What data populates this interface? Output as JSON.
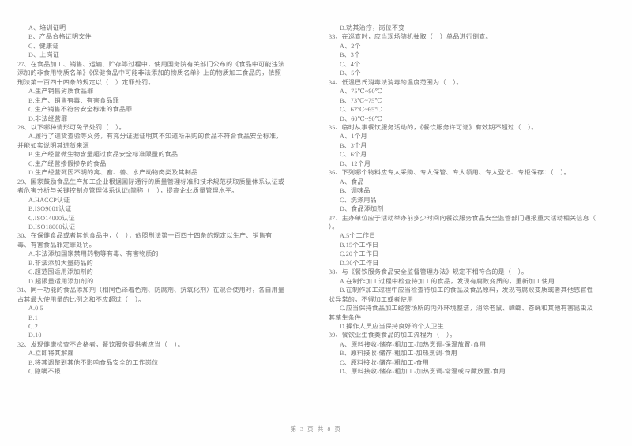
{
  "document": {
    "type": "exam-paper",
    "language": "zh-CN",
    "page_footer": "第 3 页 共 8 页"
  },
  "left_column": {
    "lines": [
      {
        "kind": "opt",
        "text": "A、培训证明"
      },
      {
        "kind": "opt",
        "text": "B、产品合格证明文件"
      },
      {
        "kind": "opt",
        "text": "C、健康证"
      },
      {
        "kind": "opt",
        "text": "D、上岗证"
      },
      {
        "kind": "q",
        "text": "27、在食品加工、销售、运输、贮存等过程中，使用国务院有关部门公布的《食品中可能违法"
      },
      {
        "kind": "q-cont",
        "text": "添加的非食用物质名单》《保健食品中可能非法添加的物质名单》上的物质加工食品的，依照"
      },
      {
        "kind": "q-cont",
        "text": "刑法第一百四十四条的规定以（    ）定罪处罚。"
      },
      {
        "kind": "opt",
        "text": "A.生产销售劣质食品罪"
      },
      {
        "kind": "opt",
        "text": "B.生产、销售有毒、有害食品罪"
      },
      {
        "kind": "opt",
        "text": "C.生产销售不符合安全标准的食品罪"
      },
      {
        "kind": "opt",
        "text": "D.非法经营罪"
      },
      {
        "kind": "q",
        "text": "28、以下哪种情形可免予处罚（    ）。"
      },
      {
        "kind": "opt",
        "text": "A.履行了进货查验等义务，有充分证据证明其不知道所采购的食品不符合食品安全标准，"
      },
      {
        "kind": "q-cont",
        "text": "并能如实说明其进货来源"
      },
      {
        "kind": "opt",
        "text": "B.生产经营微生物含量超过食品安全标准限量的食品"
      },
      {
        "kind": "opt",
        "text": "C.生产经营掺假掺杂的食品"
      },
      {
        "kind": "opt",
        "text": "D.生产经营死因不明的禽、畜、兽、水产动物肉类及其制品"
      },
      {
        "kind": "q",
        "text": "29、国家鼓励食品生产加工企业根据国际通行的质量管理标准和技术规范获取质量体系认证或"
      },
      {
        "kind": "q-cont",
        "text": "者危害分析与关键控制点管理体系认证(简称（    ），提高企业质量管理水平。"
      },
      {
        "kind": "opt",
        "text": "A.HACCP认证"
      },
      {
        "kind": "opt",
        "text": "B.ISO9001认证"
      },
      {
        "kind": "opt",
        "text": "C.ISO14000认证"
      },
      {
        "kind": "opt",
        "text": "D.ISO18000认证"
      },
      {
        "kind": "q",
        "text": "30、在保健食品或者其他食品中，（    ），依照刑法第一百四十四条的规定以生产、销售有"
      },
      {
        "kind": "q-cont",
        "text": "毒、有害食品罪定罪处罚。"
      },
      {
        "kind": "opt",
        "text": "A.非法添加国家禁用药物等有毒、有害物质的"
      },
      {
        "kind": "opt",
        "text": "B.非法添加大量药品的"
      },
      {
        "kind": "opt",
        "text": "C.超范围适用添加剂的"
      },
      {
        "kind": "opt",
        "text": "D.超限量适用添加剂的"
      },
      {
        "kind": "q",
        "text": "31、同一功能的食品添加剂（相同色泽着色剂、防腐剂、抗氧化剂）在混合使用时，各自用量"
      },
      {
        "kind": "q-cont",
        "text": "占其最大使用量的比例之和不应超过（    ）。"
      },
      {
        "kind": "opt",
        "text": "A.0.5"
      },
      {
        "kind": "opt",
        "text": "B.1"
      },
      {
        "kind": "opt",
        "text": "C.2"
      },
      {
        "kind": "opt",
        "text": "D.10"
      },
      {
        "kind": "q",
        "text": "32、发现健康检查不合格者，餐饮服务提供者应当（    ）。"
      },
      {
        "kind": "opt",
        "text": "A.立即将其解雇"
      },
      {
        "kind": "opt",
        "text": "B.将其调整到其他不影响食品安全的工作岗位"
      },
      {
        "kind": "opt",
        "text": "C.隐瞒不报"
      }
    ]
  },
  "right_column": {
    "lines": [
      {
        "kind": "opt",
        "text": "D.劝其治疗，岗位不变"
      },
      {
        "kind": "q",
        "text": "33、在巡查时，应当现场随机抽取（    ）单品进行倒查。"
      },
      {
        "kind": "opt",
        "text": "A、2个"
      },
      {
        "kind": "opt",
        "text": "B、3个"
      },
      {
        "kind": "opt",
        "text": "C、4个"
      },
      {
        "kind": "opt",
        "text": "D、5个"
      },
      {
        "kind": "q",
        "text": "34、低温巴氏消毒法消毒的温度范围为（    ）。"
      },
      {
        "kind": "opt",
        "text": "A、75℃~90℃"
      },
      {
        "kind": "opt",
        "text": "B、73℃~75℃"
      },
      {
        "kind": "opt",
        "text": "C、62℃~65℃"
      },
      {
        "kind": "opt",
        "text": "D、60℃~90℃"
      },
      {
        "kind": "q",
        "text": "35、临时从事餐饮服务活动的，《餐饮服务许可证》有效期不超过（    ）。"
      },
      {
        "kind": "opt",
        "text": "A、1个月"
      },
      {
        "kind": "opt",
        "text": "B、3个月"
      },
      {
        "kind": "opt",
        "text": "C、6个月"
      },
      {
        "kind": "opt",
        "text": "D、12个月"
      },
      {
        "kind": "q",
        "text": "36、下列哪个物料应专人采购、专人保管、专人领用、专人登记、专柜保存：（    ）。"
      },
      {
        "kind": "opt",
        "text": "A、食品"
      },
      {
        "kind": "opt",
        "text": "B、调味品"
      },
      {
        "kind": "opt",
        "text": "C、洗涤用品"
      },
      {
        "kind": "opt",
        "text": "D、食品添加剂"
      },
      {
        "kind": "q",
        "text": "37、主办单位应于活动举办前多少时间向餐饮服务食品安全监管部门通报重大活动相关信息（"
      },
      {
        "kind": "q-cont",
        "text": "）。"
      },
      {
        "kind": "opt",
        "text": "A.5个工作日"
      },
      {
        "kind": "opt",
        "text": "B.15个工作日"
      },
      {
        "kind": "opt",
        "text": "C.20个工作日"
      },
      {
        "kind": "opt",
        "text": "D.30个工作日"
      },
      {
        "kind": "q",
        "text": "38、与《餐饮服务食品安全监督管理办法》规定不相符合的是（    ）。"
      },
      {
        "kind": "opt",
        "text": "A.在制作加工过程中检查待加工的食品，发现有腐败变质的，重新加工使用"
      },
      {
        "kind": "opt",
        "text": "B.在制作加工过程中应当检查待加工的食品及食品原料，发现有腐败变质或者其他感官性"
      },
      {
        "kind": "q-cont",
        "text": "状异常的，不得加工或者使用"
      },
      {
        "kind": "opt",
        "text": "C.应当保持食品加工经营场所的内外环境整洁，消除老鼠、蟑螂、苍蝇和其他有害昆虫及"
      },
      {
        "kind": "q-cont",
        "text": "其孳生条件"
      },
      {
        "kind": "opt",
        "text": "D.操作人员应当保持良好的个人卫生"
      },
      {
        "kind": "q",
        "text": "39、餐饮业生食类食品的加工流程为（    ）。"
      },
      {
        "kind": "opt",
        "text": "A、原料接收-储存-粗加工-加热烹调-保温放置-食用"
      },
      {
        "kind": "opt",
        "text": "B、原料接收-储存-粗加工-加热烹调-食用"
      },
      {
        "kind": "opt",
        "text": "C、原料接收-储存-粗加工-食用"
      },
      {
        "kind": "opt",
        "text": "D、原料接收-储存-粗加工-加热烹调-常温或冷藏放置-食用"
      }
    ]
  }
}
